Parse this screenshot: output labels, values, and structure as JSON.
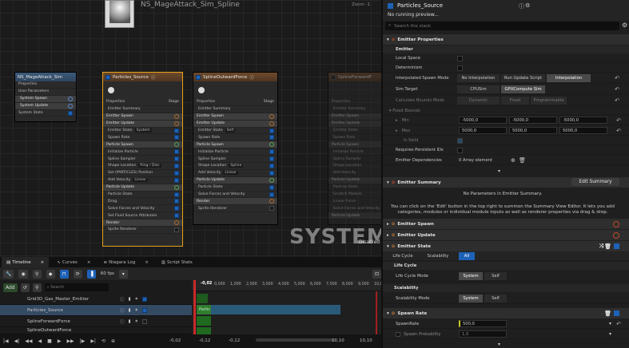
{
  "graph": {
    "title": "NS_MageAttack_Sim_Spline",
    "zoom": "Zoom -1",
    "watermark_main": "SYSTEM",
    "watermark_sub": "Disabled",
    "system_node": {
      "title": "NS_MageAttack_Sim",
      "rows": [
        "Properties",
        "User Parameters",
        "System Spawn",
        "System Update",
        "System State"
      ]
    },
    "emitter_nodes": [
      {
        "title": "Particles_Source",
        "rows": [
          "Properties",
          "Emitter Summary",
          "Emitter Spawn",
          "Emitter Update",
          "Emitter State",
          "Spawn Rate",
          "Particle Spawn",
          "Initialize Particle",
          "Spline Sampler",
          "Shape Location",
          "Set (PARTICLES) Position",
          "Add Velocity",
          "Particle Update",
          "Particle State",
          "Drag",
          "Solve Forces and Velocity",
          "Set Fluid Source Attributes",
          "Render",
          "Sprite Renderer"
        ],
        "shape_location_value": "Ring / Disc",
        "add_velocity_value": "Linear",
        "emitter_state_value": "System",
        "stage_label": "Stage"
      },
      {
        "title": "SplineOutwardForce",
        "rows": [
          "Properties",
          "Emitter Summary",
          "Emitter Spawn",
          "Emitter Update",
          "Emitter State",
          "Spawn Rate",
          "Particle Spawn",
          "Initialize Particle",
          "Spline Sampler",
          "Shape Location",
          "Add Velocity",
          "Particle Update",
          "Particle State",
          "Solve Forces and Velocity",
          "Render",
          "Sprite Renderer"
        ],
        "shape_location_value": "Spline",
        "add_velocity_value": "Linear",
        "emitter_state_value": "Self",
        "stage_label": "Stage"
      },
      {
        "title": "SplineForwardF",
        "rows": [
          "Properties",
          "Emitter Summary",
          "Emitter Spawn",
          "Emitter Update",
          "Emitter State",
          "Spawn Rate",
          "Particle Spawn",
          "Initialize Particle",
          "Spline Sampler",
          "Shape Location",
          "Add Velocity",
          "Particle Update",
          "Particle State",
          "Scratch Module",
          "Linear Force",
          "Solve Forces and Velocity",
          "Particle Update"
        ]
      }
    ]
  },
  "bottom": {
    "tabs": [
      "Timeline",
      "Curves",
      "Niagara Log",
      "Script Stats"
    ],
    "add_label": "Add",
    "search_placeholder": "Search",
    "fps": "60 fps",
    "time_indicator": "-0,02",
    "rows": [
      "Grid3D_Gas_Master_Emitter",
      "Particles_Source",
      "SplineForwardForce",
      "SplineOutwardForce"
    ],
    "bar_label": "Partic",
    "ruler": [
      "0,000",
      "1,000",
      "2,000",
      "3,000",
      "4,000",
      "5,000",
      "6,000",
      "7,000",
      "8,000",
      "9,000",
      "10,00"
    ],
    "left_time": "-0,02",
    "start_time": "-0,12",
    "start_time2": "-0,12",
    "end_time": "10,10",
    "end_time2": "10,10"
  },
  "panel": {
    "title": "Particles_Source",
    "preview_status": "No running preview...",
    "search_placeholder": "Search the stack",
    "emitter_properties": {
      "header": "Emitter Properties",
      "sub": "Emitter",
      "local_space": "Local Space",
      "determinism": "Determinism",
      "interp_mode": "Interpolated Spawn Mode",
      "interp_options": [
        "No Interpolation",
        "Run Update Script",
        "Interpolation"
      ],
      "sim_target": "Sim Target",
      "sim_options": [
        "CPUSim",
        "GPUCompute Sim"
      ],
      "bounds_mode": "Calculate Bounds Mode",
      "bounds_options": [
        "Dynamic",
        "Fixed",
        "Programmable"
      ],
      "fixed_bounds": "Fixed Bounds",
      "min": "Min",
      "max": "Max",
      "min_values": [
        "-5000,0",
        "-5000,0",
        "-5000,0"
      ],
      "max_values": [
        "5000,0",
        "5000,0",
        "5000,0"
      ],
      "is_valid": "Is Valid",
      "requires_ids": "Requires Persistent IDs",
      "deps": "Emitter Dependencies",
      "deps_value": "0 Array element"
    },
    "summary": {
      "header": "Emitter Summary",
      "edit_button": "Edit Summary",
      "line1": "No Parameters in Emitter Summary.",
      "line2": "You can click on the 'Edit' button in the top right to summon the Summary View Editor. It lets you add",
      "line3": "categories, modules or individual module inputs as well as renderer properties via drag & drop."
    },
    "emitter_spawn": "Emitter Spawn",
    "emitter_update": "Emitter Update",
    "emitter_state": {
      "header": "Emitter State",
      "filters": [
        "Life Cycle",
        "Scalability",
        "All"
      ],
      "lifecycle_sub": "Life Cycle",
      "lifecycle_mode": "Life Cycle Mode",
      "scalability_sub": "Scalability",
      "scalability_mode": "Scalability Mode",
      "mode_options": [
        "System",
        "Self"
      ]
    },
    "spawn_rate": {
      "header": "Spawn Rate",
      "rate_label": "SpawnRate",
      "rate_value": "500,0",
      "prob_label": "Spawn Probability",
      "prob_value": "1,0"
    }
  }
}
